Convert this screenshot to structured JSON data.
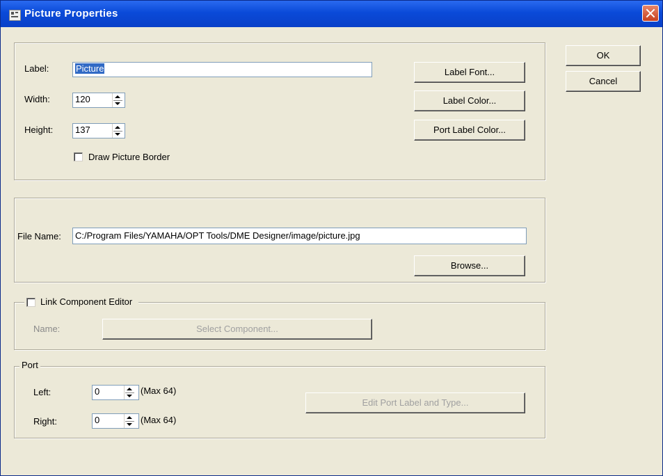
{
  "window": {
    "title": "Picture Properties"
  },
  "dialog_buttons": {
    "ok": "OK",
    "cancel": "Cancel"
  },
  "appearance": {
    "label_text": "Label:",
    "label_value": "Picture",
    "width_text": "Width:",
    "width_value": "120",
    "height_text": "Height:",
    "height_value": "137",
    "draw_border_label": "Draw Picture Border",
    "draw_border_checked": false,
    "label_font_button": "Label Font...",
    "label_color_button": "Label Color...",
    "port_label_color_button": "Port Label Color..."
  },
  "file": {
    "file_name_text": "File Name:",
    "file_name_value": "C:/Program Files/YAMAHA/OPT Tools/DME Designer/image/picture.jpg",
    "browse_button": "Browse..."
  },
  "link_component": {
    "checkbox_label": "Link Component Editor",
    "checked": false,
    "name_text": "Name:",
    "select_component_button": "Select Component..."
  },
  "port": {
    "legend": "Port",
    "left_text": "Left:",
    "left_value": "0",
    "left_max": "(Max 64)",
    "right_text": "Right:",
    "right_value": "0",
    "right_max": "(Max 64)",
    "edit_port_button": "Edit Port Label and Type..."
  }
}
